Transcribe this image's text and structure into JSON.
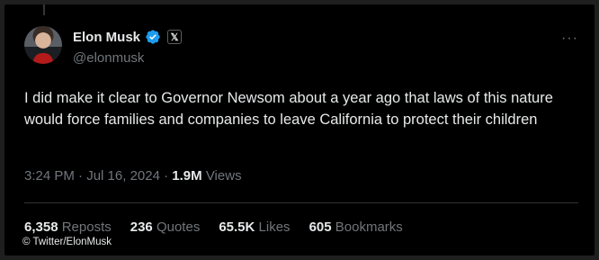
{
  "tweet": {
    "display_name": "Elon Musk",
    "handle": "@elonmusk",
    "x_badge": "𝕏",
    "more": "···",
    "text": "I did make it clear to Governor Newsom about a year ago that laws of this nature would force families and companies to leave California to protect their children",
    "time": "3:24 PM",
    "date": "Jul 16, 2024",
    "separator": "·",
    "views_count": "1.9M",
    "views_label": "Views"
  },
  "stats": [
    {
      "num": "6,358",
      "label": "Reposts"
    },
    {
      "num": "236",
      "label": "Quotes"
    },
    {
      "num": "65.5K",
      "label": "Likes"
    },
    {
      "num": "605",
      "label": "Bookmarks"
    }
  ],
  "credit": "© Twitter/ElonMusk",
  "colors": {
    "verified": "#1d9bf0",
    "background": "#000000",
    "muted": "#71767b"
  }
}
